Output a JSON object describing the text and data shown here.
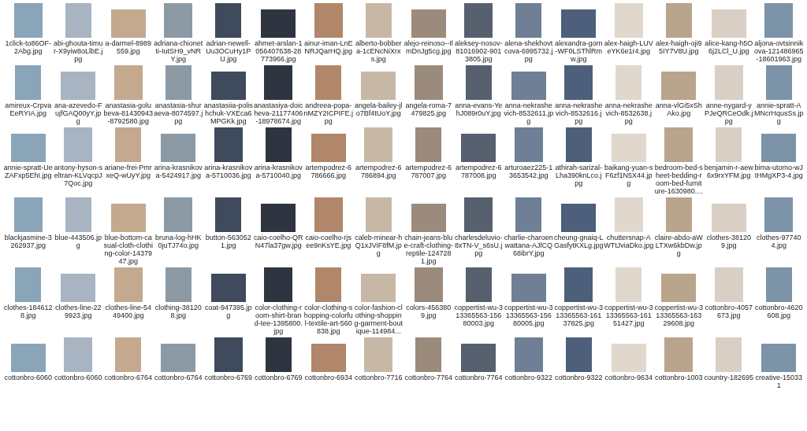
{
  "files": [
    {
      "name": "1click-to86OF-2Abg.jpg"
    },
    {
      "name": "abi-ghouta-timur-X9yiw8oLlbE.jpg"
    },
    {
      "name": "a-darmel-8989559.jpg"
    },
    {
      "name": "adriana-chionetti-IutSH9_vNRY.jpg"
    },
    {
      "name": "adrian-newell-Uu3OCuHy1PU.jpg"
    },
    {
      "name": "ahmet-arslan-1056407638-28773966.jpg"
    },
    {
      "name": "ainur-iman-LnENRJQarHQ.jpg"
    },
    {
      "name": "alberto-bobbera-1cENcNiXrxs.jpg"
    },
    {
      "name": "alejo-reinoso--IlmDnJg5cg.jpg"
    },
    {
      "name": "aleksey-nosov-81016902-9013805.jpg"
    },
    {
      "name": "alena-shekhovtcova-6995732.jpg"
    },
    {
      "name": "alexandra-gorn-WF0LSThlRmw.jpg"
    },
    {
      "name": "alex-haigh-LUVeYK6e1r4.jpg"
    },
    {
      "name": "alex-haigh-oji95IY7V8U.jpg"
    },
    {
      "name": "alice-kang-h5O6j2LCl_U.jpg"
    },
    {
      "name": "aljona-ovtsinnikova-121486965-18601963.jpg"
    },
    {
      "name": "amireux-CrpvaEeRYIA.jpg"
    },
    {
      "name": "ana-azevedo-FujfGAQ00yY.jpg"
    },
    {
      "name": "anastasia-golubeva-81430943-8792580.jpg"
    },
    {
      "name": "anastasia-shuraeva-8074597.jpg"
    },
    {
      "name": "anastasiia-polishchuk-VXEca6MPGKk.jpg"
    },
    {
      "name": "anastasiya-doicheva-21177406-18978674.jpg"
    },
    {
      "name": "andreea-popa-nMZY2ICPIFE.jpg"
    },
    {
      "name": "angela-bailey-jlo7Bf4tUoY.jpg"
    },
    {
      "name": "angela-roma-7479825.jpg"
    },
    {
      "name": "anna-evans-YehJ089r0uY.jpg"
    },
    {
      "name": "anna-nekrashevich-8532611.jpg"
    },
    {
      "name": "anna-nekrashevich-8532616.jpg"
    },
    {
      "name": "anna-nekrashevich-8532638.jpg"
    },
    {
      "name": "anna-vlGi5xShAko.jpg"
    },
    {
      "name": "anne-nygard-yPJeQRCeOdk.jpg"
    },
    {
      "name": "annie-spratt-AMNcrHqusSs.jpg"
    },
    {
      "name": "annie-spratt-UeZAFxp5EhI.jpg"
    },
    {
      "name": "antony-hyson-seltran-KLVqcpJ7Qoc.jpg"
    },
    {
      "name": "ariane-frei-PmrxeQ-wUyY.jpg"
    },
    {
      "name": "arina-krasnikova-5424917.jpg"
    },
    {
      "name": "arina-krasnikova-5710036.jpg"
    },
    {
      "name": "arina-krasnikova-5710040.jpg"
    },
    {
      "name": "artempodrez-6786666.jpg"
    },
    {
      "name": "artempodrez-6786894.jpg"
    },
    {
      "name": "artempodrez-6787007.jpg"
    },
    {
      "name": "artempodrez-6787008.jpg"
    },
    {
      "name": "arturoaez225-13653542.jpg"
    },
    {
      "name": "athirah-sarizal-Lha390knLco.jpg"
    },
    {
      "name": "baikang-yuan-sF6zf1N5X44.jpg"
    },
    {
      "name": "bedroom-bed-sheet-bedding-room-bed-furniture-1630980...."
    },
    {
      "name": "benjamin-r-aew6x9rxYFM.jpg"
    },
    {
      "name": "bima-utomo-wJtHMgXP3-4.jpg"
    },
    {
      "name": "blackjasmine-3262937.jpg"
    },
    {
      "name": "blue-443506.jpg"
    },
    {
      "name": "blue-bottom-casual-cloth-clothing-color-1437947.jpg"
    },
    {
      "name": "bruna-log-hHK0juTJ74o.jpg"
    },
    {
      "name": "button-5630521.jpg"
    },
    {
      "name": "caio-coelho-QRN47la37gw.jpg"
    },
    {
      "name": "caio-coelho-rjsee9nKsYE.jpg"
    },
    {
      "name": "caleb-minear-hQ1xJViF8fM.jpg"
    },
    {
      "name": "chain-jeans-blue-craft-clothing-reptile-1247281.jpg"
    },
    {
      "name": "charlesdeluvio-8xTN-V_s6sU.jpg"
    },
    {
      "name": "charlie-charoenwattana-AJlCQ68ibrY.jpg"
    },
    {
      "name": "cheung-gnaiq-LGasfytKXLg.jpg"
    },
    {
      "name": "chuttersnap-AWTtJviaDko.jpg"
    },
    {
      "name": "claire-abdo-aWLTXw6kbDw.jpg"
    },
    {
      "name": "clothes-381209.jpg"
    },
    {
      "name": "clothes-977404.jpg"
    },
    {
      "name": "clothes-1846128.jpg"
    },
    {
      "name": "clothes-line-229923.jpg"
    },
    {
      "name": "clothes-line-5449400.jpg"
    },
    {
      "name": "clothing-381208.jpg"
    },
    {
      "name": "coat-947395.jpg"
    },
    {
      "name": "color-clothing-room-shirt-brand-tee-1395800.jpg"
    },
    {
      "name": "color-clothing-shopping-colorful-textile-art-560838.jpg"
    },
    {
      "name": "color-fashion-clothing-shopping-garment-boutique-114984..."
    },
    {
      "name": "colors-4563809.jpg"
    },
    {
      "name": "coppertist-wu-313365563-15680003.jpg"
    },
    {
      "name": "coppertist-wu-313365563-15680005.jpg"
    },
    {
      "name": "coppertist-wu-313365563-16137825.jpg"
    },
    {
      "name": "coppertist-wu-313365563-16151427.jpg"
    },
    {
      "name": "coppertist-wu-313365563-16329608.jpg"
    },
    {
      "name": "cottonbro-4057673.jpg"
    },
    {
      "name": "cottonbro-4620608.jpg"
    },
    {
      "name": "cottonbro-6060"
    },
    {
      "name": "cottonbro-6060"
    },
    {
      "name": "cottonbro-6764"
    },
    {
      "name": "cottonbro-6764"
    },
    {
      "name": "cottonbro-6769"
    },
    {
      "name": "cottonbro-6769"
    },
    {
      "name": "cottonbro-6934"
    },
    {
      "name": "cottonbro-7716"
    },
    {
      "name": "cottonbro-7764"
    },
    {
      "name": "cottonbro-7764"
    },
    {
      "name": "cottonbro-9322"
    },
    {
      "name": "cottonbro-9322"
    },
    {
      "name": "cottonbro-9634"
    },
    {
      "name": "cottonbro-1003"
    },
    {
      "name": "country-182695"
    },
    {
      "name": "creative-150331"
    }
  ]
}
